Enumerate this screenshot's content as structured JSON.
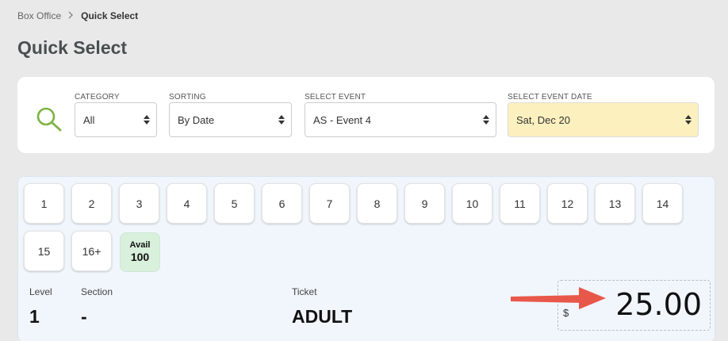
{
  "breadcrumb": {
    "root": "Box Office",
    "current": "Quick Select"
  },
  "page": {
    "title": "Quick Select"
  },
  "filters": {
    "category": {
      "label": "CATEGORY",
      "value": "All"
    },
    "sorting": {
      "label": "SORTING",
      "value": "By Date"
    },
    "event": {
      "label": "SELECT EVENT",
      "value": "AS - Event 4"
    },
    "date": {
      "label": "SELECT EVENT DATE",
      "value": "Sat, Dec 20"
    }
  },
  "quantities": [
    "1",
    "2",
    "3",
    "4",
    "5",
    "6",
    "7",
    "8",
    "9",
    "10",
    "11",
    "12",
    "13",
    "14",
    "15",
    "16+"
  ],
  "availability": {
    "label": "Avail",
    "value": "100"
  },
  "ticket_info": {
    "level_label": "Level",
    "level_value": "1",
    "section_label": "Section",
    "section_value": "-",
    "ticket_label": "Ticket",
    "ticket_value": "ADULT"
  },
  "price": {
    "currency": "$",
    "amount": "25.00"
  },
  "colors": {
    "accent_search": "#7cb342",
    "highlight_date": "#fcf0bf",
    "annotation_arrow": "#e8584a",
    "avail_badge": "#d8f0dc"
  },
  "icons": {
    "search": "search-icon",
    "sort": "sort-arrows-icon",
    "breadcrumb_sep": "chevron-right-icon"
  }
}
